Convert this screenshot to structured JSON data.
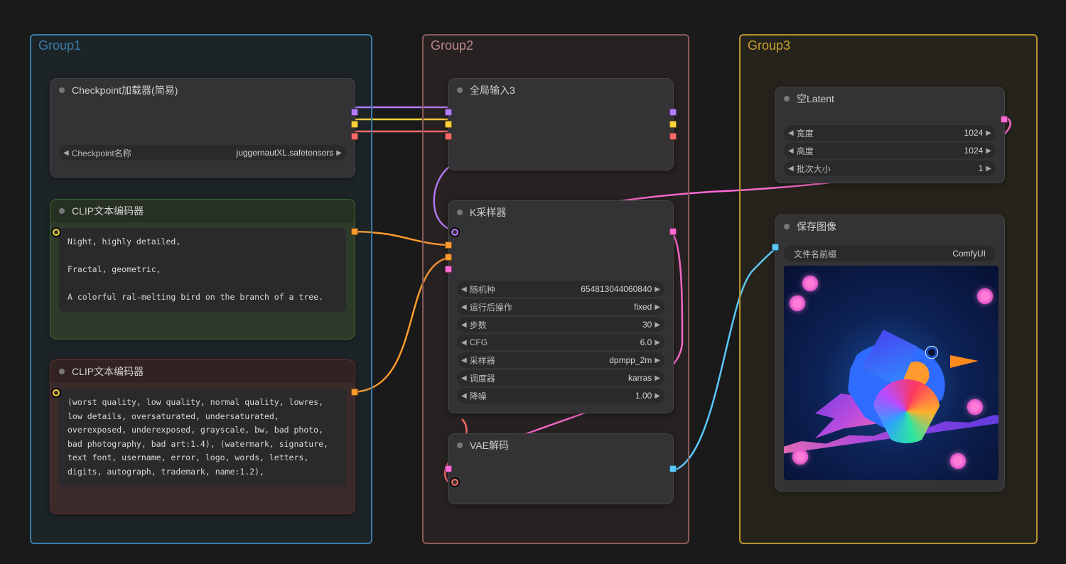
{
  "groups": {
    "g1": "Group1",
    "g2": "Group2",
    "g3": "Group3"
  },
  "checkpoint_loader": {
    "title": "Checkpoint加载器(简易)",
    "widget_label": "Checkpoint名称",
    "widget_value": "juggernautXL.safetensors"
  },
  "clip_positive": {
    "title": "CLIP文本编码器",
    "text": "Night, highly detailed,\n\nFractal, geometric,\n\nA colorful ral-melting bird on the branch of a tree."
  },
  "clip_negative": {
    "title": "CLIP文本编码器",
    "text": "(worst quality, low quality, normal quality, lowres, low details, oversaturated, undersaturated, overexposed, underexposed, grayscale, bw, bad photo, bad photography, bad art:1.4), (watermark, signature, text font, username, error, logo, words, letters, digits, autograph, trademark, name:1.2),"
  },
  "reroute": {
    "title": "全局输入3"
  },
  "ksampler": {
    "title": "K采样器",
    "widgets": [
      {
        "label": "随机种",
        "value": "654813044060840"
      },
      {
        "label": "运行后操作",
        "value": "fixed"
      },
      {
        "label": "步数",
        "value": "30"
      },
      {
        "label": "CFG",
        "value": "6.0"
      },
      {
        "label": "采样器",
        "value": "dpmpp_2m"
      },
      {
        "label": "调度器",
        "value": "karras"
      },
      {
        "label": "降噪",
        "value": "1.00"
      }
    ]
  },
  "vae_decode": {
    "title": "VAE解码"
  },
  "empty_latent": {
    "title": "空Latent",
    "widgets": [
      {
        "label": "宽度",
        "value": "1024"
      },
      {
        "label": "高度",
        "value": "1024"
      },
      {
        "label": "批次大小",
        "value": "1"
      }
    ]
  },
  "save_image": {
    "title": "保存图像",
    "prefix_label": "文件名前缀",
    "prefix_value": "ComfyUI"
  },
  "colors": {
    "model": "#b67cff",
    "clip": "#ffd23a",
    "vae": "#ff6a6a",
    "cond": "#ff9a2e",
    "latent": "#ff6ad5",
    "image": "#5ac8ff"
  }
}
